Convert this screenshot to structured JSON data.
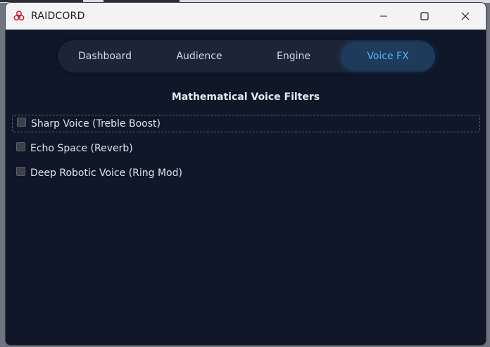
{
  "window": {
    "title": "RAIDCORD",
    "app_icon": "biohazard-icon",
    "controls": {
      "minimize": "minimize-icon",
      "maximize": "maximize-icon",
      "close": "close-icon"
    }
  },
  "tabs": [
    {
      "label": "Dashboard",
      "active": false
    },
    {
      "label": "Audience",
      "active": false
    },
    {
      "label": "Engine",
      "active": false
    },
    {
      "label": "Voice FX",
      "active": true
    }
  ],
  "voice_fx": {
    "section_title": "Mathematical Voice Filters",
    "options": [
      {
        "label": "Sharp Voice (Treble Boost)",
        "checked": false,
        "focused": true
      },
      {
        "label": "Echo Space (Reverb)",
        "checked": false,
        "focused": false
      },
      {
        "label": "Deep Robotic Voice (Ring Mod)",
        "checked": false,
        "focused": false
      }
    ]
  },
  "colors": {
    "background": "#0f1729",
    "tab_bar": "#1b2537",
    "active_tab": "#1e3b5c",
    "active_tab_text": "#4fb6f2",
    "icon_red": "#c8102e"
  }
}
